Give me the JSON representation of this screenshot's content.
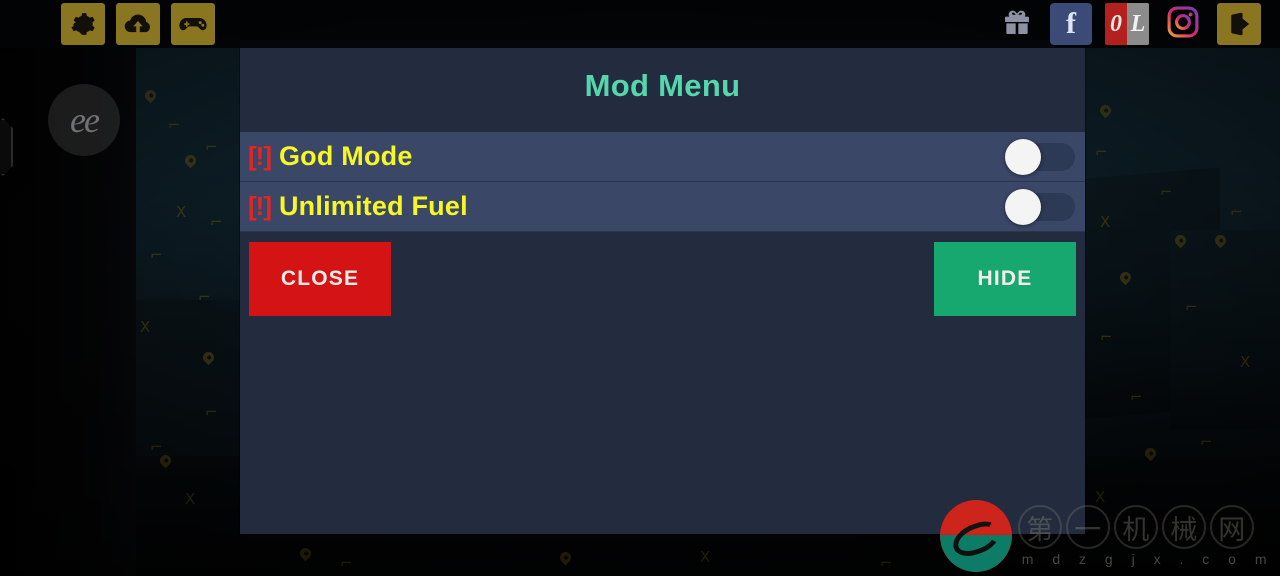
{
  "topbar": {
    "left_buttons": [
      {
        "name": "settings-button",
        "icon": "gear-icon",
        "label": ""
      },
      {
        "name": "cloud-upload-button",
        "icon": "cloud-upload-icon",
        "label": ""
      },
      {
        "name": "gamepad-button",
        "icon": "gamepad-icon",
        "label": ""
      }
    ],
    "right_buttons": [
      {
        "name": "gift-button",
        "icon": "gift-icon",
        "label": ""
      },
      {
        "name": "facebook-button",
        "icon": "facebook-icon",
        "label": "f"
      },
      {
        "name": "ol-logo-button",
        "icon": "ol-logo-icon",
        "label_left": "0",
        "label_right": "L"
      },
      {
        "name": "instagram-button",
        "icon": "instagram-icon",
        "label": ""
      },
      {
        "name": "exit-button",
        "icon": "exit-door-icon",
        "label": ""
      }
    ]
  },
  "overlay": {
    "floating_logo_text": "ee",
    "edge_handle": "drag-handle"
  },
  "panel": {
    "title": "Mod Menu",
    "accent_color": "#56d6ad",
    "background_color": "#222c3e",
    "rows": [
      {
        "marker": "[!]",
        "label": "God Mode",
        "enabled": false,
        "row_color": "#3a4767"
      },
      {
        "marker": "[!]",
        "label": "Unlimited Fuel",
        "enabled": false,
        "row_color": "#3a4767"
      }
    ],
    "buttons": {
      "close": {
        "label": "CLOSE",
        "color": "#d41414"
      },
      "hide": {
        "label": "HIDE",
        "color": "#16a86e"
      }
    }
  },
  "watermark": {
    "characters": [
      "第",
      "一",
      "机",
      "械",
      "网"
    ],
    "domain": "mdzgjx.com",
    "domain_spaced": "m d z g j x . c o m"
  }
}
